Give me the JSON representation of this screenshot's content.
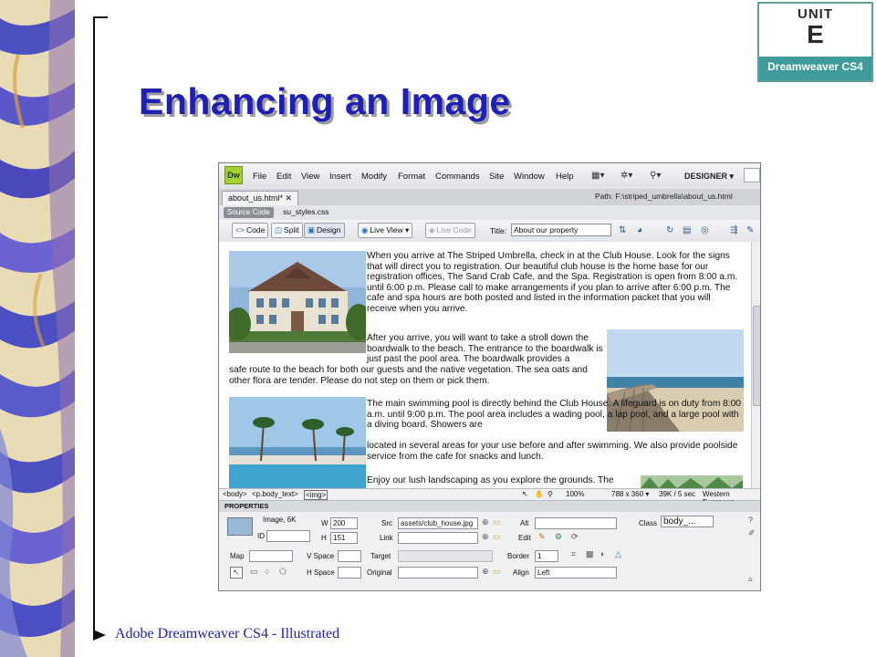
{
  "colors": {
    "title": "#1f1fb4",
    "badge_teal": "#3f9a9a",
    "footer": "#1f1fb4"
  },
  "slide": {
    "title": "Enhancing an Image",
    "footer": "Adobe Dreamweaver CS4 - Illustrated"
  },
  "badge": {
    "unit": "UNIT",
    "letter": "E",
    "product": "Dreamweaver CS4"
  },
  "dw": {
    "logo": "Dw",
    "menu": [
      "File",
      "Edit",
      "View",
      "Insert",
      "Modify",
      "Format",
      "Commands",
      "Site",
      "Window",
      "Help"
    ],
    "workspace": "DESIGNER ▾",
    "doc_tab": "about_us.html*  ✕",
    "path": "Path: F:\\striped_umbrella\\about_us.html",
    "source_code": "Source Code",
    "related_file": "su_styles.css",
    "btn_code": "Code",
    "btn_split": "Split",
    "btn_design": "Design",
    "btn_live_view": "Live View",
    "btn_live_code": "Live Code",
    "title_label": "Title:",
    "title_value": "About our property",
    "page": {
      "p1": "When you arrive at The Striped Umbrella, check in at the Club House. Look for the signs that will direct you to registration. Our beautiful club house is the home base for our registration offices, The Sand Crab Cafe, and the Spa. Registration is open from 8:00 a.m. until 6:00 p.m. Please call to make arrangements if you plan to arrive after 6:00 p.m. The cafe and spa hours are both posted and listed in the information packet that you will receive when you arrive.",
      "p2a": "After you arrive, you will want to take a stroll down the boardwalk to the beach. The entrance to the boardwalk is just past the pool area. The boardwalk provides a",
      "p2b": "safe route to the beach for both our guests and the native vegetation. The sea oats and other flora are tender. Please do not step on them or pick them.",
      "p3a": "The main swimming pool is directly behind the Club House. A lifeguard is on duty from 8:00 a.m. until 9:00 p.m. The pool area includes a wading pool, a lap pool, and a large pool with a diving board. Showers are",
      "p3b": "located in several areas for your use before and after swimming. We also provide poolside service from the cafe for snacks and lunch.",
      "p4": "Enjoy our lush landscaping as you explore the grounds. The"
    },
    "tagbar": {
      "body": "<body>",
      "pbody": "<p.body_text>",
      "img": "<img>",
      "zoom": "100%",
      "size": "788 x 360 ▾",
      "weight": "39K / 5 sec",
      "encoding": "Western European"
    },
    "props": {
      "header": "PROPERTIES",
      "image_label": "Image, 6K",
      "id_label": "ID",
      "w_label": "W",
      "w_value": "200",
      "h_label": "H",
      "h_value": "151",
      "src_label": "Src",
      "src_value": "assets/club_house.jpg",
      "link_label": "Link",
      "alt_label": "Alt",
      "edit_label": "Edit",
      "class_label": "Class",
      "class_value": "body_...",
      "map_label": "Map",
      "vspace_label": "V Space",
      "hspace_label": "H Space",
      "target_label": "Target",
      "original_label": "Original",
      "border_label": "Border",
      "border_value": "1",
      "align_label": "Align",
      "align_value": "Left"
    }
  }
}
